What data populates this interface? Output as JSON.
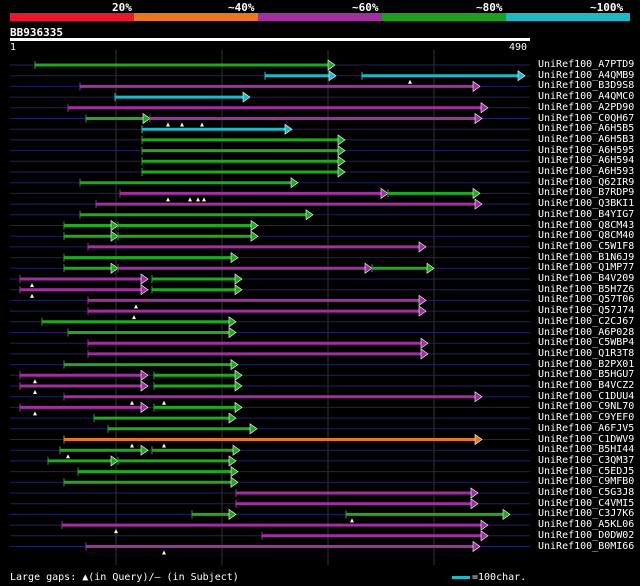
{
  "scale": {
    "labels": [
      "20%",
      "~40%",
      "~60%",
      "~80%",
      "~100%"
    ],
    "colors": [
      "#e8182c",
      "#e8781e",
      "#a030a0",
      "#1e9e1e",
      "#20b8c4"
    ]
  },
  "query": {
    "name": "BB936335",
    "start": "1",
    "end": "490"
  },
  "colors": {
    "green": "#20a820",
    "cyan": "#20b8c8",
    "purple": "#a030a0",
    "orange": "#e07820",
    "dash": "#202060"
  },
  "hits": [
    {
      "label": "UniRef100_A7PTD9",
      "segs": [
        [
          "green",
          35,
          335
        ]
      ],
      "gaps": []
    },
    {
      "label": "UniRef100_A4QMB9",
      "segs": [
        [
          "cyan",
          265,
          336
        ],
        [
          "cyan",
          362,
          525
        ]
      ],
      "gaps": [
        410
      ]
    },
    {
      "label": "UniRef100_B3D9S8",
      "segs": [
        [
          "purple",
          80,
          480
        ]
      ],
      "gaps": []
    },
    {
      "label": "UniRef100_A4QMC0",
      "segs": [
        [
          "cyan",
          115,
          250
        ]
      ],
      "gaps": []
    },
    {
      "label": "UniRef100_A2PD90",
      "segs": [
        [
          "purple",
          68,
          488
        ]
      ],
      "gaps": []
    },
    {
      "label": "UniRef100_C0QH67",
      "segs": [
        [
          "green",
          86,
          150
        ],
        [
          "purple",
          150,
          482
        ]
      ],
      "gaps": [
        168,
        182,
        202
      ]
    },
    {
      "label": "UniRef100_A6H5B5",
      "segs": [
        [
          "cyan",
          142,
          292
        ]
      ],
      "gaps": []
    },
    {
      "label": "UniRef100_A6H5B3",
      "segs": [
        [
          "green",
          142,
          345
        ]
      ],
      "gaps": []
    },
    {
      "label": "UniRef100_A6H595",
      "segs": [
        [
          "green",
          142,
          345
        ]
      ],
      "gaps": []
    },
    {
      "label": "UniRef100_A6H594",
      "segs": [
        [
          "green",
          142,
          345
        ]
      ],
      "gaps": []
    },
    {
      "label": "UniRef100_A6H593",
      "segs": [
        [
          "green",
          142,
          345
        ]
      ],
      "gaps": []
    },
    {
      "label": "UniRef100_Q62IR9",
      "segs": [
        [
          "green",
          80,
          298
        ]
      ],
      "gaps": []
    },
    {
      "label": "UniRef100_B7RDP9",
      "segs": [
        [
          "purple",
          120,
          388
        ],
        [
          "green",
          388,
          480
        ]
      ],
      "gaps": [
        168,
        190,
        198,
        204
      ]
    },
    {
      "label": "UniRef100_Q3BKI1",
      "segs": [
        [
          "purple",
          96,
          482
        ]
      ],
      "gaps": []
    },
    {
      "label": "UniRef100_B4YIG7",
      "segs": [
        [
          "green",
          80,
          313
        ]
      ],
      "gaps": []
    },
    {
      "label": "UniRef100_Q8CM43",
      "segs": [
        [
          "green",
          64,
          118
        ],
        [
          "green",
          118,
          258
        ]
      ],
      "gaps": []
    },
    {
      "label": "UniRef100_Q8CM40",
      "segs": [
        [
          "green",
          64,
          118
        ],
        [
          "green",
          118,
          258
        ]
      ],
      "gaps": []
    },
    {
      "label": "UniRef100_C5W1F8",
      "segs": [
        [
          "purple",
          88,
          426
        ]
      ],
      "gaps": []
    },
    {
      "label": "UniRef100_B1N6J9",
      "segs": [
        [
          "green",
          64,
          238
        ]
      ],
      "gaps": []
    },
    {
      "label": "UniRef100_Q1MP77",
      "segs": [
        [
          "green",
          64,
          118
        ],
        [
          "purple",
          118,
          372
        ],
        [
          "green",
          372,
          434
        ]
      ],
      "gaps": []
    },
    {
      "label": "UniRef100_B4V209",
      "segs": [
        [
          "purple",
          20,
          148
        ],
        [
          "green",
          152,
          242
        ]
      ],
      "gaps": [
        32
      ]
    },
    {
      "label": "UniRef100_B5H7Z6",
      "segs": [
        [
          "purple",
          20,
          148
        ],
        [
          "green",
          152,
          242
        ]
      ],
      "gaps": [
        32
      ]
    },
    {
      "label": "UniRef100_Q57T06",
      "segs": [
        [
          "purple",
          88,
          426
        ]
      ],
      "gaps": [
        136
      ]
    },
    {
      "label": "UniRef100_Q57J74",
      "segs": [
        [
          "purple",
          88,
          426
        ]
      ],
      "gaps": [
        134
      ]
    },
    {
      "label": "UniRef100_C2CJ67",
      "segs": [
        [
          "green",
          42,
          236
        ]
      ],
      "gaps": []
    },
    {
      "label": "UniRef100_A6P028",
      "segs": [
        [
          "green",
          68,
          236
        ]
      ],
      "gaps": []
    },
    {
      "label": "UniRef100_C5WBP4",
      "segs": [
        [
          "purple",
          88,
          428
        ]
      ],
      "gaps": []
    },
    {
      "label": "UniRef100_Q1R3T8",
      "segs": [
        [
          "purple",
          88,
          428
        ]
      ],
      "gaps": []
    },
    {
      "label": "UniRef100_B2PX01",
      "segs": [
        [
          "green",
          64,
          238
        ]
      ],
      "gaps": []
    },
    {
      "label": "UniRef100_B5HGU7",
      "segs": [
        [
          "purple",
          20,
          148
        ],
        [
          "green",
          154,
          242
        ]
      ],
      "gaps": [
        35
      ]
    },
    {
      "label": "UniRef100_B4VCZ2",
      "segs": [
        [
          "purple",
          20,
          148
        ],
        [
          "green",
          154,
          242
        ]
      ],
      "gaps": [
        35
      ]
    },
    {
      "label": "UniRef100_C1DUU4",
      "segs": [
        [
          "purple",
          64,
          482
        ]
      ],
      "gaps": [
        132,
        164
      ]
    },
    {
      "label": "UniRef100_C9NL70",
      "segs": [
        [
          "purple",
          20,
          148
        ],
        [
          "green",
          154,
          242
        ]
      ],
      "gaps": [
        35
      ]
    },
    {
      "label": "UniRef100_C9YEF0",
      "segs": [
        [
          "green",
          94,
          236
        ]
      ],
      "gaps": []
    },
    {
      "label": "UniRef100_A6FJV5",
      "segs": [
        [
          "green",
          108,
          257
        ]
      ],
      "gaps": []
    },
    {
      "label": "UniRef100_C1DWV9",
      "segs": [
        [
          "orange",
          64,
          482
        ]
      ],
      "gaps": [
        132,
        164
      ]
    },
    {
      "label": "UniRef100_B5HI44",
      "segs": [
        [
          "green",
          60,
          148
        ],
        [
          "green",
          152,
          240
        ]
      ],
      "gaps": [
        68
      ]
    },
    {
      "label": "UniRef100_C3QM37",
      "segs": [
        [
          "green",
          48,
          118
        ],
        [
          "green",
          118,
          236
        ]
      ],
      "gaps": []
    },
    {
      "label": "UniRef100_C5EDJ5",
      "segs": [
        [
          "green",
          78,
          238
        ]
      ],
      "gaps": []
    },
    {
      "label": "UniRef100_C9MFB0",
      "segs": [
        [
          "green",
          64,
          238
        ]
      ],
      "gaps": []
    },
    {
      "label": "UniRef100_C5G3J8",
      "segs": [
        [
          "purple",
          236,
          478
        ]
      ],
      "gaps": []
    },
    {
      "label": "UniRef100_C4VMI5",
      "segs": [
        [
          "purple",
          236,
          478
        ]
      ],
      "gaps": []
    },
    {
      "label": "UniRef100_C3J7K6",
      "segs": [
        [
          "green",
          192,
          236
        ],
        [
          "green",
          346,
          510
        ]
      ],
      "gaps": [
        352
      ]
    },
    {
      "label": "UniRef100_A5KL06",
      "segs": [
        [
          "purple",
          62,
          488
        ]
      ],
      "gaps": [
        116
      ]
    },
    {
      "label": "UniRef100_D0DW02",
      "segs": [
        [
          "purple",
          262,
          488
        ]
      ],
      "gaps": []
    },
    {
      "label": "UniRef100_B0MI66",
      "segs": [
        [
          "purple",
          86,
          480
        ]
      ],
      "gaps": [
        164
      ]
    }
  ],
  "legend": {
    "text": "Large gaps: ▲(in Query)/— (in Subject)",
    "scale_text": "=100char."
  }
}
